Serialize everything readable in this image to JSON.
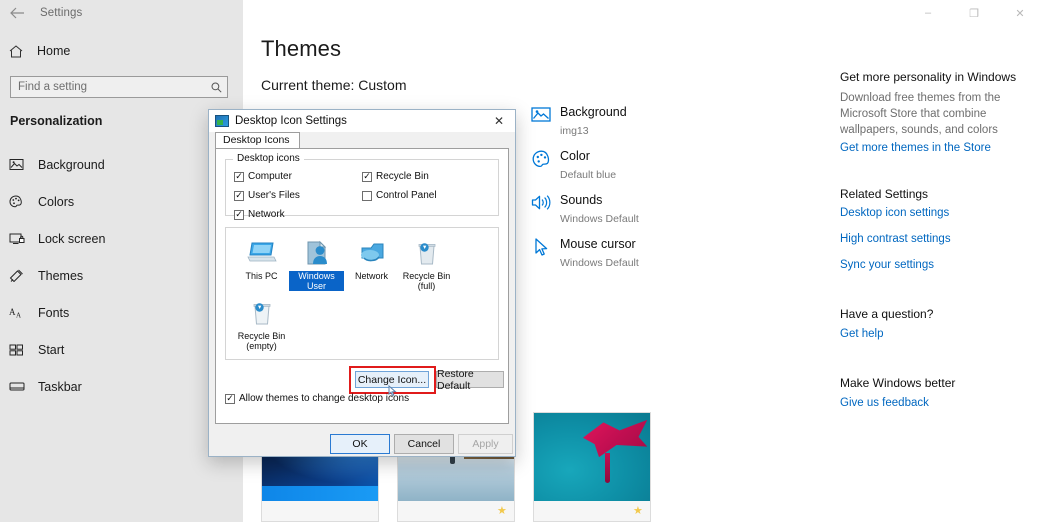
{
  "window": {
    "app_title": "Settings",
    "back_icon": "back-arrow-icon",
    "minimize": "–",
    "maximize": "❐",
    "close": "✕"
  },
  "sidebar": {
    "home_label": "Home",
    "home_icon": "home-icon",
    "search": {
      "placeholder": "Find a setting",
      "value": "",
      "icon": "search-icon"
    },
    "section_title": "Personalization",
    "items": [
      {
        "label": "Background",
        "icon": "picture-icon"
      },
      {
        "label": "Colors",
        "icon": "palette-icon"
      },
      {
        "label": "Lock screen",
        "icon": "lock-screen-icon"
      },
      {
        "label": "Themes",
        "icon": "themes-icon"
      },
      {
        "label": "Fonts",
        "icon": "fonts-icon"
      },
      {
        "label": "Start",
        "icon": "start-icon"
      },
      {
        "label": "Taskbar",
        "icon": "taskbar-icon"
      }
    ]
  },
  "main": {
    "page_title": "Themes",
    "current_theme": "Current theme: Custom",
    "summary": [
      {
        "title": "Background",
        "value": "img13",
        "icon": "picture-icon"
      },
      {
        "title": "Color",
        "value": "Default blue",
        "icon": "palette-icon"
      },
      {
        "title": "Sounds",
        "value": "Windows Default",
        "icon": "speaker-icon"
      },
      {
        "title": "Mouse cursor",
        "value": "Windows Default",
        "icon": "cursor-icon"
      }
    ],
    "thumbnails": [
      {
        "name": "windows-theme-thumb",
        "star": ""
      },
      {
        "name": "beach-theme-thumb",
        "star": "★"
      },
      {
        "name": "flower-theme-thumb",
        "star": "★"
      }
    ]
  },
  "rail": {
    "personality_heading": "Get more personality in Windows",
    "personality_text": "Download free themes from the Microsoft Store that combine wallpapers, sounds, and colors",
    "personality_link": "Get more themes in the Store",
    "related_heading": "Related Settings",
    "related_links": [
      "Desktop icon settings",
      "High contrast settings",
      "Sync your settings"
    ],
    "question_heading": "Have a question?",
    "question_link": "Get help",
    "better_heading": "Make Windows better",
    "better_link": "Give us feedback"
  },
  "dialog": {
    "title": "Desktop Icon Settings",
    "icon": "desktop-icon-settings-icon",
    "close": "✕",
    "tab": "Desktop Icons",
    "group_caption": "Desktop icons",
    "checkboxes_left": [
      {
        "label": "Computer",
        "checked": true
      },
      {
        "label": "User's Files",
        "checked": true
      },
      {
        "label": "Network",
        "checked": true
      }
    ],
    "checkboxes_right": [
      {
        "label": "Recycle Bin",
        "checked": true
      },
      {
        "label": "Control Panel",
        "checked": false
      }
    ],
    "check_glyph": "✓",
    "preview_icons_row1": [
      {
        "label": "This PC",
        "icon": "this-pc-icon",
        "selected": false
      },
      {
        "label": "Windows User",
        "icon": "user-files-icon",
        "selected": true
      },
      {
        "label": "Network",
        "icon": "network-icon",
        "selected": false
      },
      {
        "label": "Recycle Bin (full)",
        "icon": "recycle-bin-full-icon",
        "selected": false
      }
    ],
    "preview_icons_row2": [
      {
        "label": "Recycle Bin (empty)",
        "icon": "recycle-bin-empty-icon",
        "selected": false
      }
    ],
    "change_icon_button": "Change Icon...",
    "restore_default_button": "Restore Default",
    "allow_themes_label": "Allow themes to change desktop icons",
    "allow_themes_checked": true,
    "ok_button": "OK",
    "cancel_button": "Cancel",
    "apply_button": "Apply",
    "highlight_color": "#e01b1b"
  }
}
